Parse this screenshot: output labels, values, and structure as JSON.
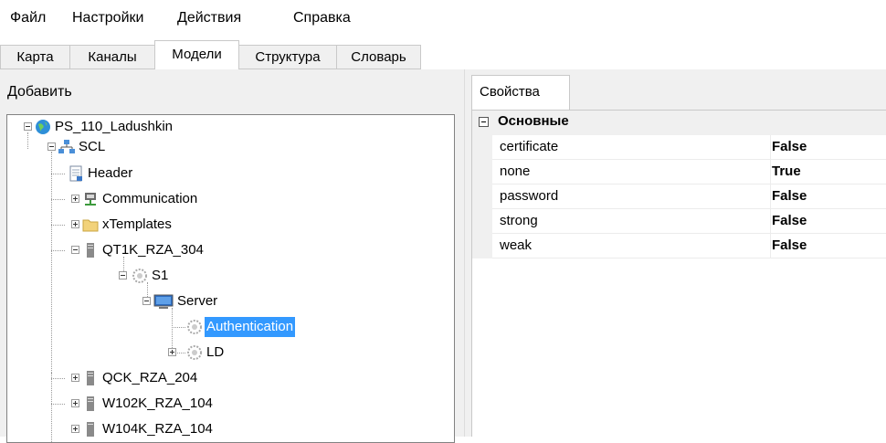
{
  "menu": [
    "Файл",
    "Настройки",
    "Действия",
    "Справка"
  ],
  "tabs": [
    "Карта",
    "Каналы",
    "Модели",
    "Структура",
    "Словарь"
  ],
  "active_tab": "Модели",
  "left": {
    "add_label": "Добавить",
    "tree": {
      "root": "PS_110_Ladushkin",
      "scl": "SCL",
      "header": "Header",
      "communication": "Communication",
      "xtemplates": "xTemplates",
      "ied1": "QT1K_RZA_304",
      "s1": "S1",
      "server": "Server",
      "authentication": "Authentication",
      "ld": "LD",
      "ied2": "QCK_RZA_204",
      "ied3": "W102K_RZA_104",
      "ied4": "W104K_RZA_104"
    }
  },
  "right": {
    "tab_label": "Свойства",
    "category": "Основные",
    "properties": [
      {
        "name": "certificate",
        "value": "False"
      },
      {
        "name": "none",
        "value": "True"
      },
      {
        "name": "password",
        "value": "False"
      },
      {
        "name": "strong",
        "value": "False"
      },
      {
        "name": "weak",
        "value": "False"
      }
    ]
  },
  "colors": {
    "selection": "#3399ff",
    "panel_bg": "#f0f0f0",
    "globe": "#2e8fd8",
    "folder": "#f2d27a",
    "monitor": "#2d6cc0"
  },
  "icons": {
    "root": "globe-icon",
    "scl": "network-icon",
    "header": "document-icon",
    "communication": "network-device-icon",
    "xtemplates": "folder-icon",
    "ied": "server-icon",
    "access_point": "gear-cluster-icon",
    "server": "monitor-icon"
  }
}
